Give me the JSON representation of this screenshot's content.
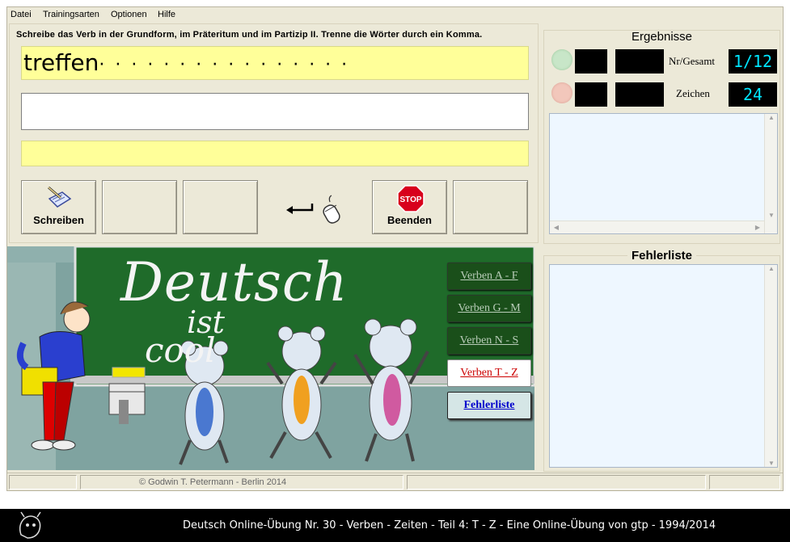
{
  "menu": [
    "Datei",
    "Trainingsarten",
    "Optionen",
    "Hilfe"
  ],
  "instruction": "Schreibe das Verb in der Grundform, im Präteritum und im Partizip II. Trenne die Wörter durch ein Komma.",
  "verb": {
    "word": "treffen",
    "dots": "· · · · · · · · · · · · · · · ·"
  },
  "answer_field": {
    "value": ""
  },
  "feedback_field": {
    "value": ""
  },
  "toolbar": {
    "schreiben_label": "Schreiben",
    "beenden_label": "Beenden",
    "stop_sign_text": "STOP"
  },
  "results": {
    "title": "Ergebnisse",
    "nr_gesamt_label": "Nr/Gesamt",
    "nr_gesamt_value": "1/12",
    "zeichen_label": "Zeichen",
    "zeichen_value": "24",
    "colors": {
      "lamp_green": "#c8e6c8",
      "lamp_red": "#f2c7bb",
      "counter_text": "#00e5ff"
    }
  },
  "fehlerliste": {
    "title": "Fehlerliste"
  },
  "chalkboard": {
    "line1": "Deutsch",
    "line2": "ist",
    "line3": "cool"
  },
  "verb_buttons": [
    {
      "label": "Verben A - F"
    },
    {
      "label": "Verben G - M"
    },
    {
      "label": "Verben N - S"
    },
    {
      "label": "Verben T - Z"
    }
  ],
  "fehlerliste_button": "Fehlerliste",
  "status": {
    "copyright": "© Godwin T. Petermann - Berlin 2014"
  },
  "footer": {
    "text": "Deutsch Online-Übung Nr. 30 - Verben - Zeiten - Teil 4: T - Z - Eine Online-Übung von gtp - 1994/2014"
  }
}
